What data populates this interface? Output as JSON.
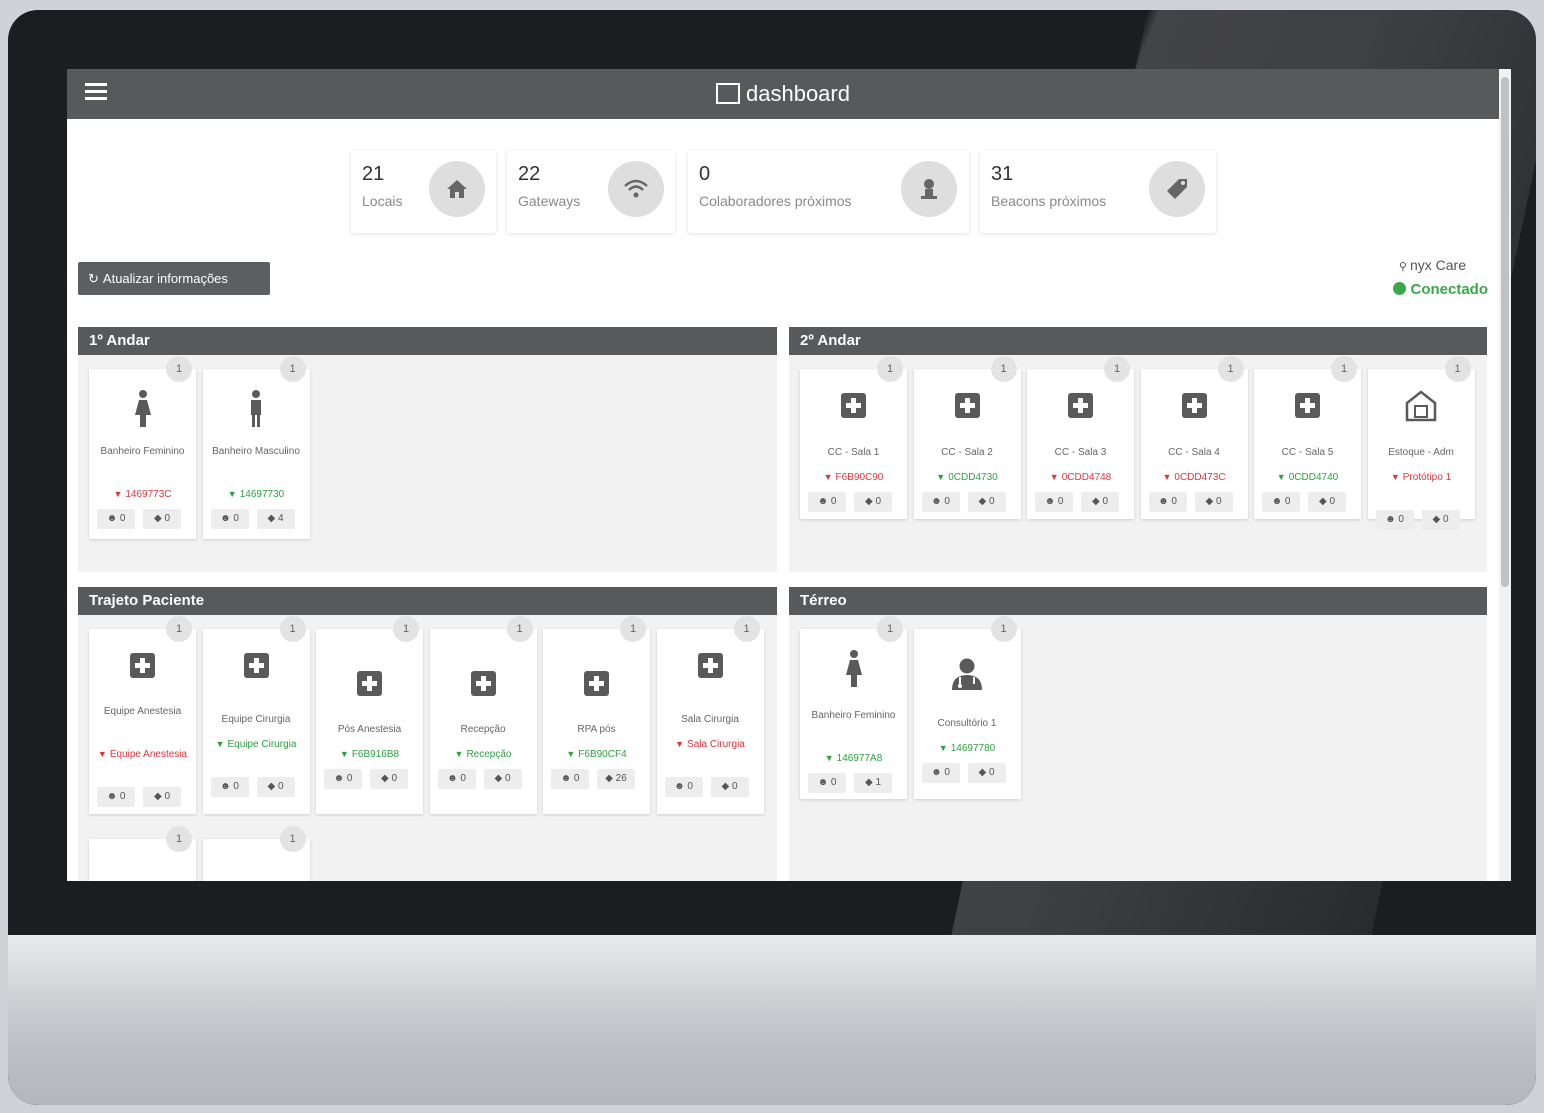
{
  "appbar": {
    "title": "dashboard"
  },
  "stats": [
    {
      "value": "21",
      "label": "Locais",
      "icon": "home-icon"
    },
    {
      "value": "22",
      "label": "Gateways",
      "icon": "wifi-icon"
    },
    {
      "value": "0",
      "label": "Colaboradores próximos",
      "icon": "person-icon"
    },
    {
      "value": "31",
      "label": "Beacons próximos",
      "icon": "tag-icon"
    }
  ],
  "refresh_label": "Atualizar informações",
  "connection": {
    "name": "nyx Care",
    "status": "Conectado"
  },
  "colors": {
    "bar": "#58595b",
    "ok": "#2ea043",
    "error": "#d9363e"
  },
  "panels": [
    {
      "title": "1º Andar",
      "cards": [
        {
          "count": "1",
          "icon": "female-icon",
          "name": "Banheiro Feminino",
          "gateway": "1469773C",
          "gw_status": "error",
          "persons": "0",
          "tags": "0"
        },
        {
          "count": "1",
          "icon": "male-icon",
          "name": "Banheiro Masculino",
          "gateway": "14697730",
          "gw_status": "ok",
          "persons": "0",
          "tags": "4"
        }
      ]
    },
    {
      "title": "2º Andar",
      "cards": [
        {
          "count": "1",
          "icon": "plus-icon",
          "name": "CC - Sala 1",
          "gateway": "F6B90C90",
          "gw_status": "error",
          "persons": "0",
          "tags": "0"
        },
        {
          "count": "1",
          "icon": "plus-icon",
          "name": "CC - Sala 2",
          "gateway": "0CDD4730",
          "gw_status": "ok",
          "persons": "0",
          "tags": "0"
        },
        {
          "count": "1",
          "icon": "plus-icon",
          "name": "CC - Sala 3",
          "gateway": "0CDD4748",
          "gw_status": "error",
          "persons": "0",
          "tags": "0"
        },
        {
          "count": "1",
          "icon": "plus-icon",
          "name": "CC - Sala 4",
          "gateway": "0CDD473C",
          "gw_status": "error",
          "persons": "0",
          "tags": "0"
        },
        {
          "count": "1",
          "icon": "plus-icon",
          "name": "CC - Sala 5",
          "gateway": "0CDD4740",
          "gw_status": "ok",
          "persons": "0",
          "tags": "0"
        },
        {
          "count": "1",
          "icon": "warehouse-icon",
          "name": "Estoque - Adm",
          "gateway": "Protótipo 1",
          "gw_status": "error",
          "persons": "0",
          "tags": "0"
        }
      ]
    },
    {
      "title": "Trajeto Paciente",
      "cards": [
        {
          "count": "1",
          "icon": "plus-icon",
          "name": "Equipe Anestesia",
          "gateway": "Equipe Anestesia",
          "gw_status": "error",
          "persons": "0",
          "tags": "0"
        },
        {
          "count": "1",
          "icon": "plus-icon",
          "name": "Equipe Cirurgia",
          "gateway": "Equipe Cirurgia",
          "gw_status": "ok",
          "persons": "0",
          "tags": "0"
        },
        {
          "count": "1",
          "icon": "plus-icon",
          "name": "Pós Anestesia",
          "gateway": "F6B916B8",
          "gw_status": "ok",
          "persons": "0",
          "tags": "0"
        },
        {
          "count": "1",
          "icon": "plus-icon",
          "name": "Recepção",
          "gateway": "Recepção",
          "gw_status": "ok",
          "persons": "0",
          "tags": "0"
        },
        {
          "count": "1",
          "icon": "plus-icon",
          "name": "RPA pós",
          "gateway": "F6B90CF4",
          "gw_status": "ok",
          "persons": "0",
          "tags": "26"
        },
        {
          "count": "1",
          "icon": "plus-icon",
          "name": "Sala Cirurgia",
          "gateway": "Sala Cirurgia",
          "gw_status": "error",
          "persons": "0",
          "tags": "0"
        },
        {
          "count": "1"
        },
        {
          "count": "1"
        }
      ]
    },
    {
      "title": "Térreo",
      "cards": [
        {
          "count": "1",
          "icon": "female-icon",
          "name": "Banheiro Feminino",
          "gateway": "146977A8",
          "gw_status": "ok",
          "persons": "0",
          "tags": "1"
        },
        {
          "count": "1",
          "icon": "doctor-icon",
          "name": "Consultório 1",
          "gateway": "14697780",
          "gw_status": "ok",
          "persons": "0",
          "tags": "0"
        }
      ]
    }
  ]
}
